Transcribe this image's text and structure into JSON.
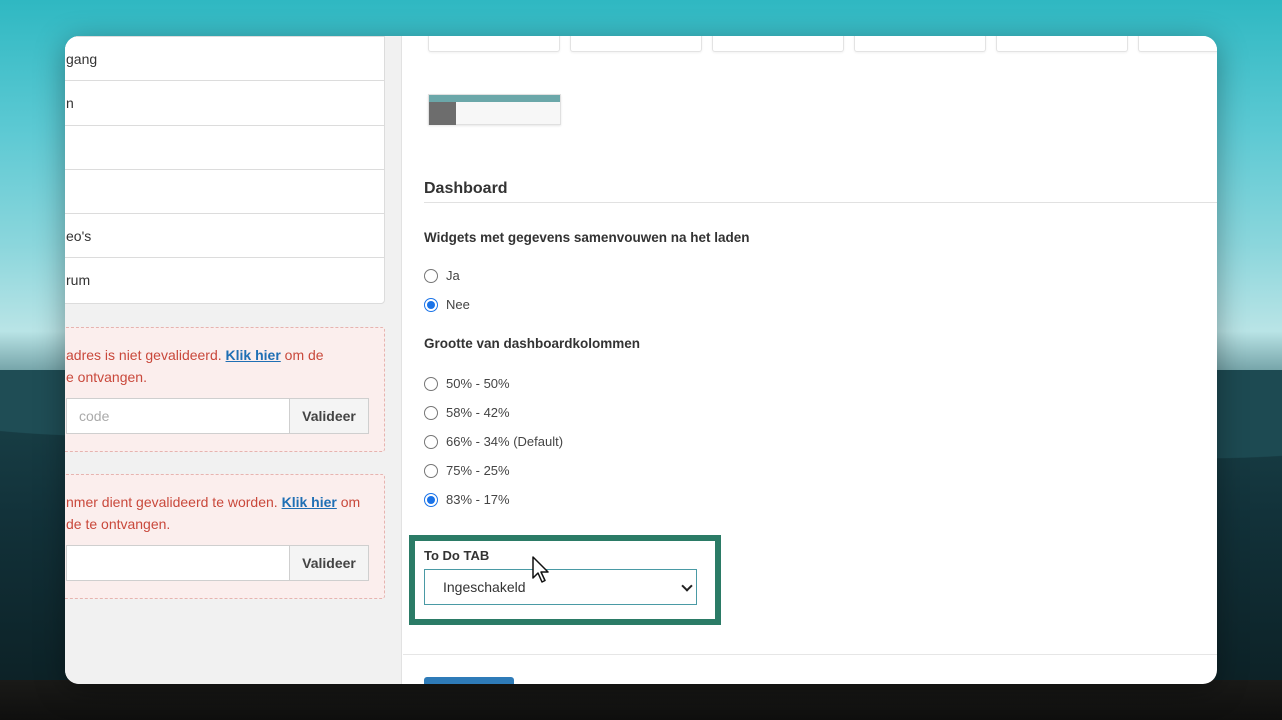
{
  "menu": {
    "items": [
      {
        "label": "gang"
      },
      {
        "label": "n"
      },
      {
        "label": ""
      },
      {
        "label": ""
      },
      {
        "label": "eo's"
      },
      {
        "label": "rum"
      }
    ]
  },
  "alerts": [
    {
      "text_before": "adres is niet gevalideerd. ",
      "link": "Klik hier",
      "text_after": " om de",
      "line2": "e ontvangen.",
      "input_placeholder": "code",
      "button": "Valideer"
    },
    {
      "text_before": "nmer dient gevalideerd te worden. ",
      "link": "Klik hier",
      "text_after": " om",
      "line2": "de te ontvangen.",
      "input_placeholder": "",
      "button": "Valideer"
    }
  ],
  "dashboard": {
    "title": "Dashboard",
    "collapse_question": "Widgets met gegevens samenvouwen na het laden",
    "collapse_options": [
      {
        "label": "Ja",
        "selected": false
      },
      {
        "label": "Nee",
        "selected": true
      }
    ],
    "columns_question": "Grootte van dashboardkolommen",
    "columns_options": [
      {
        "label": "50% - 50%",
        "selected": false
      },
      {
        "label": "58% - 42%",
        "selected": false
      },
      {
        "label": "66% - 34% (Default)",
        "selected": false
      },
      {
        "label": "75% - 25%",
        "selected": false
      },
      {
        "label": "83% - 17%",
        "selected": true
      }
    ],
    "todo_label": "To Do TAB",
    "todo_value": "Ingeschakeld"
  },
  "colors": {
    "accent": "#1a73e8",
    "highlight": "#2b7b66",
    "alert_text": "#c9483b",
    "link": "#1f6fb4"
  }
}
